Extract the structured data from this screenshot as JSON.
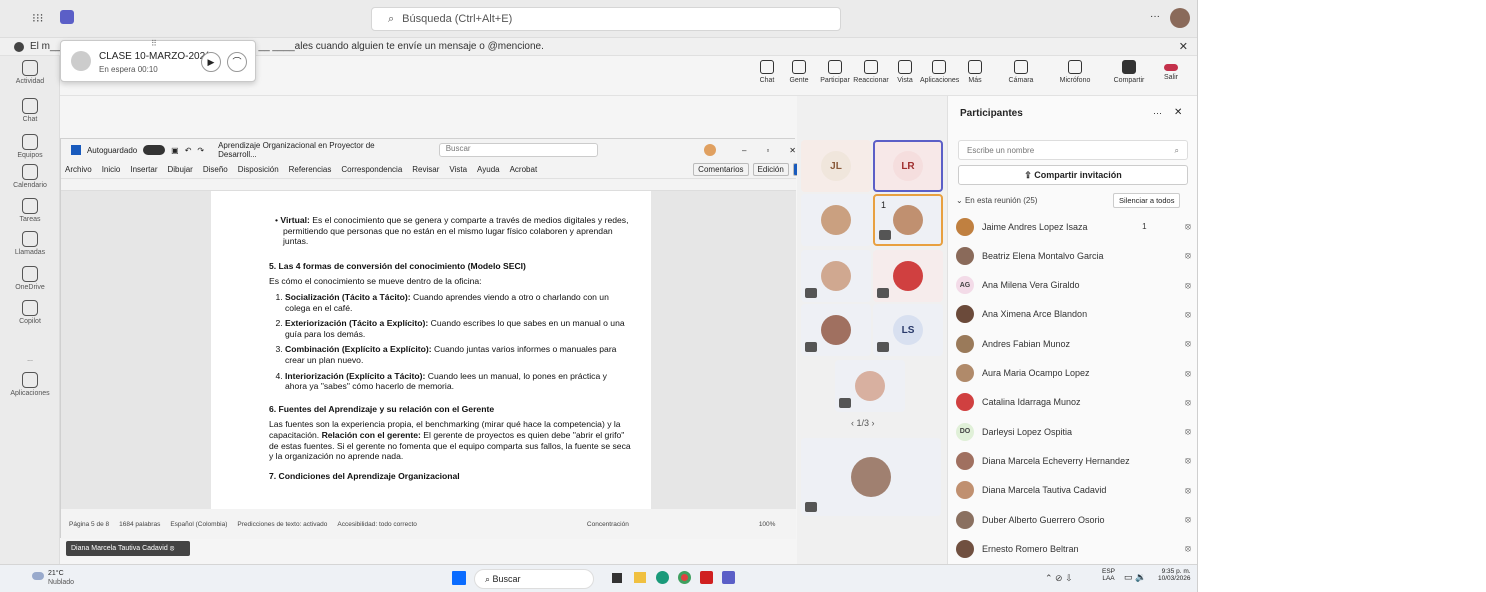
{
  "titlebar": {
    "search": "Búsqueda (Ctrl+Alt+E)"
  },
  "notif": "El m____ __ _____ __ __________ __ _ _____ __ __ ____ales cuando alguien te envíe un mensaje o @mencione.",
  "call": {
    "title": "CLASE 10-MARZO-202(",
    "status": "En espera  00:10"
  },
  "rail": [
    "Actividad",
    "Chat",
    "Equipos",
    "Calendario",
    "Tareas",
    "Llamadas",
    "OneDrive",
    "Copilot",
    "...",
    "Aplicaciones"
  ],
  "toolbar": [
    "Chat",
    "Gente",
    "Participar",
    "Reaccionar",
    "Vista",
    "Aplicaciones",
    "Más",
    "Cámara",
    "Micrófono",
    "Compartir",
    "Salir"
  ],
  "word": {
    "title": "Aprendizaje Organizacional en Proyector de Desarroll...",
    "autosave": "Autoguardado",
    "search": "Buscar",
    "menu": [
      "Archivo",
      "Inicio",
      "Insertar",
      "Dibujar",
      "Diseño",
      "Disposición",
      "Referencias",
      "Correspondencia",
      "Revisar",
      "Vista",
      "Ayuda",
      "Acrobat"
    ],
    "comments": "Comentarios",
    "edit": "Edición",
    "share": "Compartir",
    "virtual_label": "Virtual:",
    "virtual_text": " Es el conocimiento que se genera y comparte a través de medios digitales y redes, permitiendo que personas que no están en el mismo lugar físico colaboren y aprendan juntas.",
    "h5": "5. Las 4 formas de conversión del conocimiento (Modelo SECI)",
    "p5": "Es cómo el conocimiento se mueve dentro de la oficina:",
    "items": [
      {
        "b": "Socialización (Tácito a Tácito):",
        "t": " Cuando aprendes viendo a otro o charlando con un colega en el café."
      },
      {
        "b": "Exteriorización (Tácito a Explícito):",
        "t": " Cuando escribes lo que sabes en un manual o una guía para los demás."
      },
      {
        "b": "Combinación (Explícito a Explícito):",
        "t": " Cuando juntas varios informes o manuales para crear un plan nuevo."
      },
      {
        "b": "Interiorización (Explícito a Tácito):",
        "t": " Cuando lees un manual, lo pones en práctica y ahora ya \"sabes\" cómo hacerlo de memoria."
      }
    ],
    "h6": "6. Fuentes del Aprendizaje y su relación con el Gerente",
    "p6a": "Las fuentes son la experiencia propia, el benchmarking (mirar qué hace la competencia) y la capacitación. ",
    "p6b": "Relación con el gerente:",
    "p6c": " El gerente de proyectos es quien debe \"abrir el grifo\" de estas fuentes. Si el gerente no fomenta que el equipo comparta sus fallos, la fuente se seca y la organización no aprende nada.",
    "h7": "7. Condiciones del Aprendizaje Organizacional",
    "status": [
      "Página 5 de 8",
      "1684 palabras",
      "Español (Colombia)",
      "Predicciones de texto: activado",
      "Accesibilidad: todo correcto",
      "Concentración",
      "100%"
    ]
  },
  "videos": {
    "jl": "JL",
    "lr": "LR",
    "ls": "LS",
    "pager": "1/3",
    "hand": "1"
  },
  "panel": {
    "title": "Participantes",
    "search": "Escribe un nombre",
    "invite": "Compartir invitación",
    "section": "En esta reunión (25)",
    "mute_all": "Silenciar a todos",
    "people": [
      {
        "n": "Jaime Andres Lopez Isaza",
        "c": "#c08040",
        "h": "1"
      },
      {
        "n": "Beatriz Elena Montalvo Garcia",
        "c": "#8a6a5a"
      },
      {
        "n": "Ana Milena Vera Giraldo",
        "c": "#f3dbe8",
        "i": "AG"
      },
      {
        "n": "Ana Ximena Arce Blandon",
        "c": "#6b4a3a"
      },
      {
        "n": "Andres Fabian Munoz",
        "c": "#9a7a5a"
      },
      {
        "n": "Aura Maria Ocampo Lopez",
        "c": "#b08a6a"
      },
      {
        "n": "Catalina Idarraga Munoz",
        "c": "#d04040"
      },
      {
        "n": "Darleysi Lopez Ospitia",
        "c": "#e0f0d8",
        "i": "DO"
      },
      {
        "n": "Diana Marcela Echeverry Hernandez",
        "c": "#a07060"
      },
      {
        "n": "Diana Marcela Tautiva Cadavid",
        "c": "#c09070"
      },
      {
        "n": "Duber Alberto Guerrero Osorio",
        "c": "#8a7060"
      },
      {
        "n": "Ernesto Romero Beltran",
        "c": "#705040"
      }
    ]
  },
  "vidlabel": "Diana Marcela Tautiva Cadavid",
  "taskbar": {
    "temp": "21°C",
    "weather": "Nublado",
    "search": "Buscar",
    "lang": "ESP",
    "lang2": "LAA",
    "time": "9:35 p. m.",
    "date": "10/03/2026"
  }
}
